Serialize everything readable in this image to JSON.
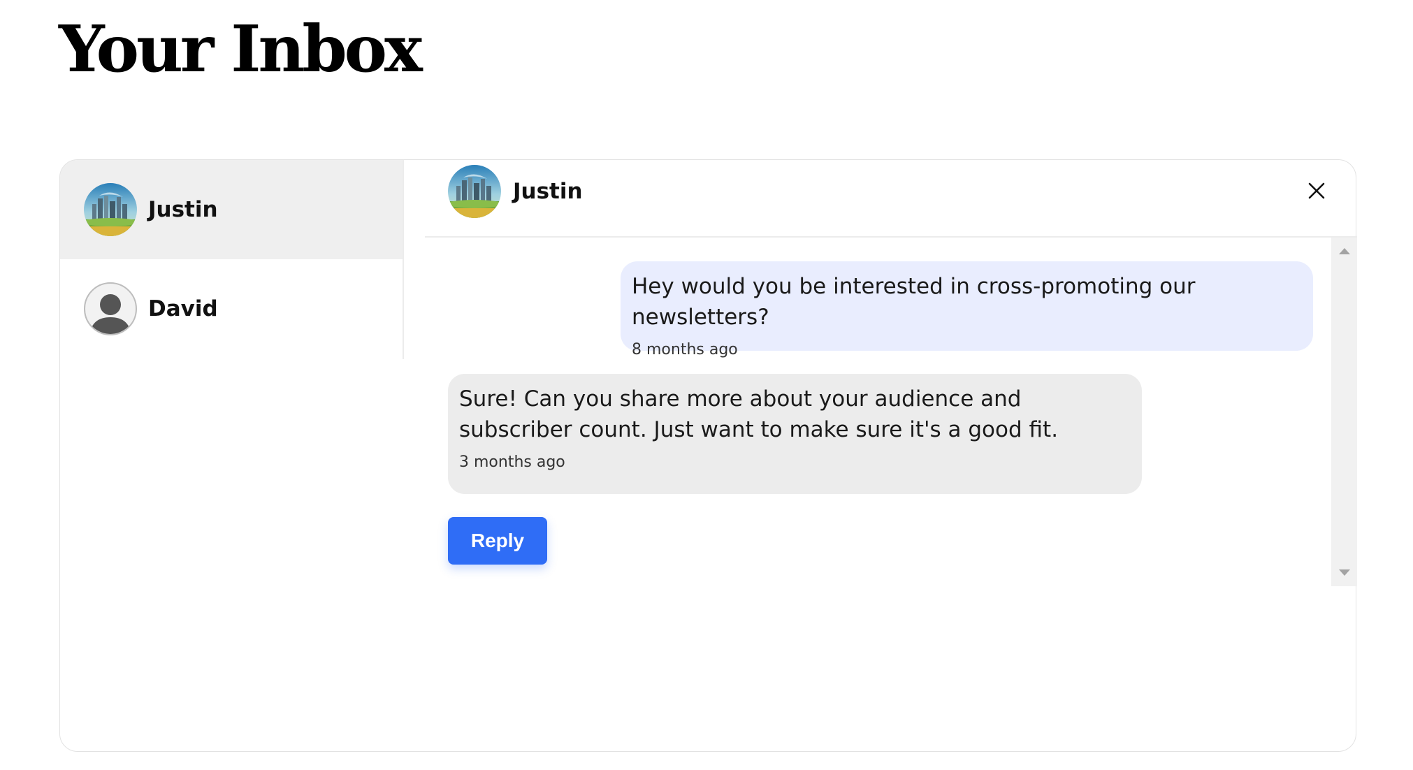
{
  "page": {
    "title": "Your Inbox"
  },
  "conversations": [
    {
      "name": "Justin",
      "avatar": "landscape-avatar",
      "selected": true
    },
    {
      "name": "David",
      "avatar": "default-user-avatar",
      "selected": false
    }
  ],
  "chat": {
    "contact_name": "Justin",
    "avatar": "landscape-avatar",
    "close_icon": "close-icon",
    "messages": [
      {
        "direction": "outgoing",
        "text": "Hey would you be interested in cross-promoting our newsletters?",
        "time": "8 months ago"
      },
      {
        "direction": "incoming",
        "text": "Sure! Can you share more about your audience and subscriber count. Just want to make sure it's a good fit.",
        "time": "3 months ago"
      }
    ],
    "reply_label": "Reply"
  },
  "colors": {
    "selected_row": "#efefef",
    "outgoing_bubble": "#e9edfe",
    "incoming_bubble": "#ececec",
    "reply_button": "#2f6df6"
  }
}
